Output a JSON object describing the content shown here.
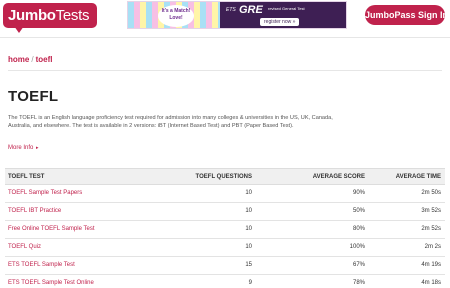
{
  "header": {
    "logo": {
      "part1": "Jumbo",
      "part2": "Tests"
    },
    "banner": {
      "left_text": "It's a Match! Love!",
      "ets": "ETS",
      "gre": "GRE",
      "revised": "revised General Test",
      "register": "register now »"
    },
    "signin_label": "JumboPass Sign In"
  },
  "breadcrumb": {
    "home": "home",
    "separator": "/",
    "current": "toefl"
  },
  "page_title": "TOEFL",
  "description": "The TOEFL is an English language proficiency test required for admission into many colleges & universities in the US, UK, Canada, Australia, and elsewhere. The test is available in 2 versions: iBT (Internet Based Test) and PBT (Paper Based Test).",
  "more_info": {
    "label": "More Info",
    "arrow": "▸"
  },
  "table": {
    "headers": [
      "TOEFL TEST",
      "TOEFL QUESTIONS",
      "AVERAGE SCORE",
      "AVERAGE TIME"
    ],
    "rows": [
      {
        "name": "TOEFL Sample Test Papers",
        "questions": "10",
        "score": "90%",
        "time": "2m 50s"
      },
      {
        "name": "TOEFL IBT Practice",
        "questions": "10",
        "score": "50%",
        "time": "3m 52s"
      },
      {
        "name": "Free Online TOEFL Sample Test",
        "questions": "10",
        "score": "80%",
        "time": "2m 52s"
      },
      {
        "name": "TOEFL Quiz",
        "questions": "10",
        "score": "100%",
        "time": "2m 2s"
      },
      {
        "name": "ETS TOEFL Sample Test",
        "questions": "15",
        "score": "67%",
        "time": "4m 19s"
      },
      {
        "name": "ETS TOEFL Sample Test Online",
        "questions": "9",
        "score": "78%",
        "time": "4m 18s"
      }
    ]
  },
  "colors": {
    "brand": "#c0224c",
    "header_row_bg": "#f0f0f0",
    "text": "#333333"
  }
}
